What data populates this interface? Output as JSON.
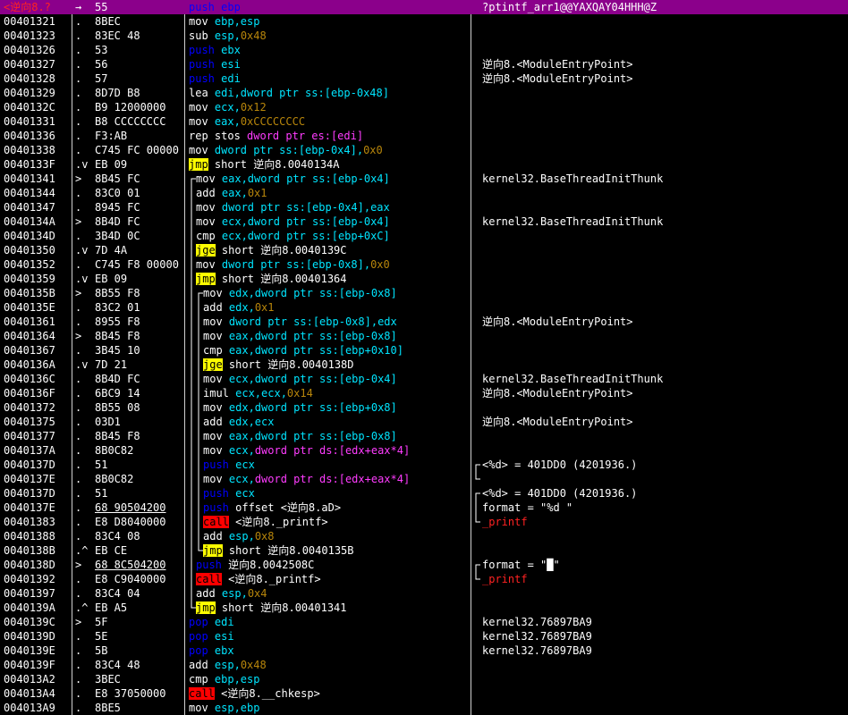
{
  "window": {
    "title": "逆向8"
  },
  "colors": {
    "selection": "#8b008b",
    "immediate": "#b8860b",
    "register": "#00e5ff",
    "segment": "#ff3cff",
    "jump_bg": "#ffff00",
    "call_bg": "#ff0000"
  },
  "rows": [
    {
      "addr": "<逆向8.?",
      "mark": "→",
      "hex": "55",
      "code": [
        [
          "push ebp",
          "w"
        ]
      ],
      "comment": "?ptintf_arr1@@YAXQAY04HHH@Z",
      "selected": true
    },
    {
      "addr": "00401321",
      "mark": ".",
      "hex": "8BEC",
      "code": [
        [
          "mov ",
          "w"
        ],
        [
          "ebp,esp",
          "reg"
        ]
      ],
      "comment": ""
    },
    {
      "addr": "00401323",
      "mark": ".",
      "hex": "83EC 48",
      "code": [
        [
          "sub ",
          "w"
        ],
        [
          "esp,",
          "reg"
        ],
        [
          "0x48",
          "imm"
        ]
      ],
      "comment": ""
    },
    {
      "addr": "00401326",
      "mark": ".",
      "hex": "53",
      "code": [
        [
          "push ",
          "push"
        ],
        [
          "ebx",
          "reg"
        ]
      ],
      "comment": ""
    },
    {
      "addr": "00401327",
      "mark": ".",
      "hex": "56",
      "code": [
        [
          "push ",
          "push"
        ],
        [
          "esi",
          "reg"
        ]
      ],
      "comment": "逆向8.<ModuleEntryPoint>"
    },
    {
      "addr": "00401328",
      "mark": ".",
      "hex": "57",
      "code": [
        [
          "push ",
          "push"
        ],
        [
          "edi",
          "reg"
        ]
      ],
      "comment": "逆向8.<ModuleEntryPoint>"
    },
    {
      "addr": "00401329",
      "mark": ".",
      "hex": "8D7D B8",
      "code": [
        [
          "lea ",
          "w"
        ],
        [
          "edi,dword ptr ss:[ebp-0x48]",
          "reg"
        ]
      ],
      "comment": ""
    },
    {
      "addr": "0040132C",
      "mark": ".",
      "hex": "B9 12000000",
      "code": [
        [
          "mov ",
          "w"
        ],
        [
          "ecx,",
          "reg"
        ],
        [
          "0x12",
          "imm"
        ]
      ],
      "comment": ""
    },
    {
      "addr": "00401331",
      "mark": ".",
      "hex": "B8 CCCCCCCC",
      "code": [
        [
          "mov ",
          "w"
        ],
        [
          "eax,",
          "reg"
        ],
        [
          "0xCCCCCCCC",
          "imm"
        ]
      ],
      "comment": ""
    },
    {
      "addr": "00401336",
      "mark": ".",
      "hex": "F3:AB",
      "code": [
        [
          "rep stos ",
          "w"
        ],
        [
          "dword ptr es:[edi]",
          "seg"
        ]
      ],
      "comment": ""
    },
    {
      "addr": "00401338",
      "mark": ".",
      "hex": "C745 FC 00000",
      "code": [
        [
          "mov ",
          "w"
        ],
        [
          "dword ptr ss:[ebp-0x4],",
          "reg"
        ],
        [
          "0x0",
          "imm"
        ]
      ],
      "comment": ""
    },
    {
      "addr": "0040133F",
      "mark": ".v",
      "hex": "EB 09",
      "code": [
        [
          "jmp",
          "jmp"
        ],
        [
          " short 逆向8.0040134A",
          "w"
        ]
      ],
      "comment": ""
    },
    {
      "addr": "00401341",
      "mark": ">",
      "hex": "8B45 FC",
      "code": [
        [
          "mov ",
          "w"
        ],
        [
          "eax,dword ptr ss:[ebp-0x4]",
          "reg"
        ]
      ],
      "comment": "kernel32.BaseThreadInitThunk",
      "indent": 1
    },
    {
      "addr": "00401344",
      "mark": ".",
      "hex": "83C0 01",
      "code": [
        [
          "add ",
          "w"
        ],
        [
          "eax,",
          "reg"
        ],
        [
          "0x1",
          "imm"
        ]
      ],
      "comment": "",
      "indent": 1
    },
    {
      "addr": "00401347",
      "mark": ".",
      "hex": "8945 FC",
      "code": [
        [
          "mov ",
          "w"
        ],
        [
          "dword ptr ss:[ebp-0x4],eax",
          "reg"
        ]
      ],
      "comment": "",
      "indent": 1
    },
    {
      "addr": "0040134A",
      "mark": ">",
      "hex": "8B4D FC",
      "code": [
        [
          "mov ",
          "w"
        ],
        [
          "ecx,dword ptr ss:[ebp-0x4]",
          "reg"
        ]
      ],
      "comment": "kernel32.BaseThreadInitThunk",
      "indent": 1
    },
    {
      "addr": "0040134D",
      "mark": ".",
      "hex": "3B4D 0C",
      "code": [
        [
          "cmp ",
          "w"
        ],
        [
          "ecx,dword ptr ss:[ebp+0xC]",
          "reg"
        ]
      ],
      "comment": "",
      "indent": 1
    },
    {
      "addr": "00401350",
      "mark": ".v",
      "hex": "7D 4A",
      "code": [
        [
          "jge",
          "jcc"
        ],
        [
          " short 逆向8.0040139C",
          "w"
        ]
      ],
      "comment": "",
      "indent": 1
    },
    {
      "addr": "00401352",
      "mark": ".",
      "hex": "C745 F8 00000",
      "code": [
        [
          "mov ",
          "w"
        ],
        [
          "dword ptr ss:[ebp-0x8],",
          "reg"
        ],
        [
          "0x0",
          "imm"
        ]
      ],
      "comment": "",
      "indent": 1
    },
    {
      "addr": "00401359",
      "mark": ".v",
      "hex": "EB 09",
      "code": [
        [
          "jmp",
          "jmp"
        ],
        [
          " short 逆向8.00401364",
          "w"
        ]
      ],
      "comment": "",
      "indent": 1
    },
    {
      "addr": "0040135B",
      "mark": ">",
      "hex": "8B55 F8",
      "code": [
        [
          "mov ",
          "w"
        ],
        [
          "edx,dword ptr ss:[ebp-0x8]",
          "reg"
        ]
      ],
      "comment": "",
      "indent": 2
    },
    {
      "addr": "0040135E",
      "mark": ".",
      "hex": "83C2 01",
      "code": [
        [
          "add ",
          "w"
        ],
        [
          "edx,",
          "reg"
        ],
        [
          "0x1",
          "imm"
        ]
      ],
      "comment": "",
      "indent": 2
    },
    {
      "addr": "00401361",
      "mark": ".",
      "hex": "8955 F8",
      "code": [
        [
          "mov ",
          "w"
        ],
        [
          "dword ptr ss:[ebp-0x8],edx",
          "reg"
        ]
      ],
      "comment": "逆向8.<ModuleEntryPoint>",
      "indent": 2
    },
    {
      "addr": "00401364",
      "mark": ">",
      "hex": "8B45 F8",
      "code": [
        [
          "mov ",
          "w"
        ],
        [
          "eax,dword ptr ss:[ebp-0x8]",
          "reg"
        ]
      ],
      "comment": "",
      "indent": 2
    },
    {
      "addr": "00401367",
      "mark": ".",
      "hex": "3B45 10",
      "code": [
        [
          "cmp ",
          "w"
        ],
        [
          "eax,dword ptr ss:[ebp+0x10]",
          "reg"
        ]
      ],
      "comment": "",
      "indent": 2
    },
    {
      "addr": "0040136A",
      "mark": ".v",
      "hex": "7D 21",
      "code": [
        [
          "jge",
          "jcc"
        ],
        [
          " short 逆向8.0040138D",
          "w"
        ]
      ],
      "comment": "",
      "indent": 2
    },
    {
      "addr": "0040136C",
      "mark": ".",
      "hex": "8B4D FC",
      "code": [
        [
          "mov ",
          "w"
        ],
        [
          "ecx,dword ptr ss:[ebp-0x4]",
          "reg"
        ]
      ],
      "comment": "kernel32.BaseThreadInitThunk",
      "indent": 2
    },
    {
      "addr": "0040136F",
      "mark": ".",
      "hex": "6BC9 14",
      "code": [
        [
          "imul ",
          "w"
        ],
        [
          "ecx,ecx,",
          "reg"
        ],
        [
          "0x14",
          "imm"
        ]
      ],
      "comment": "逆向8.<ModuleEntryPoint>",
      "indent": 2
    },
    {
      "addr": "00401372",
      "mark": ".",
      "hex": "8B55 08",
      "code": [
        [
          "mov ",
          "w"
        ],
        [
          "edx,dword ptr ss:[ebp+0x8]",
          "reg"
        ]
      ],
      "comment": "",
      "indent": 2
    },
    {
      "addr": "00401375",
      "mark": ".",
      "hex": "03D1",
      "code": [
        [
          "add ",
          "w"
        ],
        [
          "edx,ecx",
          "reg"
        ]
      ],
      "comment": "逆向8.<ModuleEntryPoint>",
      "indent": 2
    },
    {
      "addr": "00401377",
      "mark": ".",
      "hex": "8B45 F8",
      "code": [
        [
          "mov ",
          "w"
        ],
        [
          "eax,dword ptr ss:[ebp-0x8]",
          "reg"
        ]
      ],
      "comment": "",
      "indent": 2
    },
    {
      "addr": "0040137A",
      "mark": ".",
      "hex": "8B0C82",
      "code": [
        [
          "mov ",
          "w"
        ],
        [
          "ecx,",
          "reg"
        ],
        [
          "dword ptr ds:[edx+eax*4]",
          "seg"
        ]
      ],
      "comment": "",
      "indent": 2
    },
    {
      "addr": "0040137D",
      "mark": ".",
      "hex": "51",
      "code": [
        [
          "push ",
          "push"
        ],
        [
          "ecx",
          "reg"
        ]
      ],
      "comment": "<%d> = 401DD0 (4201936.)",
      "indent": 2
    },
    {
      "addr": "0040137E",
      "mark": ".",
      "hex": "8B0C82",
      "code": [
        [
          "mov ",
          "w"
        ],
        [
          "ecx,",
          "reg"
        ],
        [
          "dword ptr ds:[edx+eax*4]",
          "seg"
        ]
      ],
      "comment": "",
      "indent": 2
    },
    {
      "addr": "0040137D",
      "mark": ".",
      "hex": "51",
      "code": [
        [
          "push ",
          "push"
        ],
        [
          "ecx",
          "reg"
        ]
      ],
      "comment": "<%d> = 401DD0 (4201936.)",
      "indent": 2
    },
    {
      "addr": "0040137E",
      "mark": ".",
      "hex": "68 90504200",
      "code": [
        [
          "push ",
          "push"
        ],
        [
          "offset <逆向8.aD>",
          "w"
        ]
      ],
      "comment": "format = \"%d \"",
      "indent": 2,
      "hexul": true
    },
    {
      "addr": "00401383",
      "mark": ".",
      "hex": "E8 D8040000",
      "code": [
        [
          "call",
          "call"
        ],
        [
          " <逆向8._printf>",
          "w"
        ]
      ],
      "comment": "_printf",
      "cmtred": true,
      "indent": 2
    },
    {
      "addr": "00401388",
      "mark": ".",
      "hex": "83C4 08",
      "code": [
        [
          "add ",
          "w"
        ],
        [
          "esp,",
          "reg"
        ],
        [
          "0x8",
          "imm"
        ]
      ],
      "comment": "",
      "indent": 2
    },
    {
      "addr": "0040138B",
      "mark": ".^",
      "hex": "EB CE",
      "code": [
        [
          "jmp",
          "jmp"
        ],
        [
          " short 逆向8.0040135B",
          "w"
        ]
      ],
      "comment": "",
      "indent": 2
    },
    {
      "addr": "0040138D",
      "mark": ">",
      "hex": "68 8C504200",
      "code": [
        [
          "push ",
          "push"
        ],
        [
          "逆向8.0042508C",
          "w"
        ]
      ],
      "comment": "format = \"█\"",
      "indent": 1,
      "hexul": true
    },
    {
      "addr": "00401392",
      "mark": ".",
      "hex": "E8 C9040000",
      "code": [
        [
          "call",
          "call"
        ],
        [
          " <逆向8._printf>",
          "w"
        ]
      ],
      "comment": "_printf",
      "cmtred": true,
      "indent": 1
    },
    {
      "addr": "00401397",
      "mark": ".",
      "hex": "83C4 04",
      "code": [
        [
          "add ",
          "w"
        ],
        [
          "esp,",
          "reg"
        ],
        [
          "0x4",
          "imm"
        ]
      ],
      "comment": "",
      "indent": 1
    },
    {
      "addr": "0040139A",
      "mark": ".^",
      "hex": "EB A5",
      "code": [
        [
          "jmp",
          "jmp"
        ],
        [
          " short 逆向8.00401341",
          "w"
        ]
      ],
      "comment": "",
      "indent": 1
    },
    {
      "addr": "0040139C",
      "mark": ">",
      "hex": "5F",
      "code": [
        [
          "pop ",
          "pop"
        ],
        [
          "edi",
          "reg"
        ]
      ],
      "comment": "kernel32.76897BA9"
    },
    {
      "addr": "0040139D",
      "mark": ".",
      "hex": "5E",
      "code": [
        [
          "pop ",
          "pop"
        ],
        [
          "esi",
          "reg"
        ]
      ],
      "comment": "kernel32.76897BA9"
    },
    {
      "addr": "0040139E",
      "mark": ".",
      "hex": "5B",
      "code": [
        [
          "pop ",
          "pop"
        ],
        [
          "ebx",
          "reg"
        ]
      ],
      "comment": "kernel32.76897BA9"
    },
    {
      "addr": "0040139F",
      "mark": ".",
      "hex": "83C4 48",
      "code": [
        [
          "add ",
          "w"
        ],
        [
          "esp,",
          "reg"
        ],
        [
          "0x48",
          "imm"
        ]
      ],
      "comment": ""
    },
    {
      "addr": "004013A2",
      "mark": ".",
      "hex": "3BEC",
      "code": [
        [
          "cmp ",
          "w"
        ],
        [
          "ebp,esp",
          "reg"
        ]
      ],
      "comment": ""
    },
    {
      "addr": "004013A4",
      "mark": ".",
      "hex": "E8 37050000",
      "code": [
        [
          "call",
          "call"
        ],
        [
          " <逆向8.__chkesp>",
          "w"
        ]
      ],
      "comment": ""
    },
    {
      "addr": "004013A9",
      "mark": ".",
      "hex": "8BE5",
      "code": [
        [
          "mov ",
          "w"
        ],
        [
          "esp,ebp",
          "reg"
        ]
      ],
      "comment": ""
    }
  ]
}
